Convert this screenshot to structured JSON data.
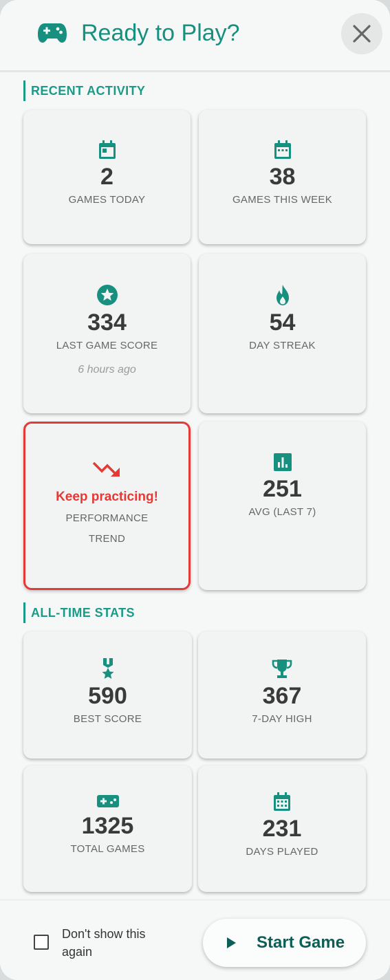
{
  "header": {
    "title": "Ready to Play?",
    "icon": "gamepad-icon",
    "close_icon": "close-icon"
  },
  "colors": {
    "accent": "#17907f",
    "alert": "#e53935",
    "button_text": "#0b5f56"
  },
  "recent": {
    "title": "RECENT ACTIVITY",
    "games_today": {
      "value": "2",
      "label": "GAMES TODAY",
      "icon": "calendar-today-icon"
    },
    "games_week": {
      "value": "38",
      "label": "GAMES THIS WEEK",
      "icon": "calendar-week-icon"
    },
    "last_score": {
      "value": "334",
      "label": "LAST GAME SCORE",
      "meta": "6 hours ago",
      "icon": "star-icon"
    },
    "streak": {
      "value": "54",
      "label": "DAY STREAK",
      "icon": "fire-icon"
    },
    "trend": {
      "message": "Keep practicing!",
      "label_line1": "PERFORMANCE",
      "label_line2": "TREND",
      "icon": "trending-down-icon"
    },
    "avg": {
      "value": "251",
      "label": "AVG (LAST 7)",
      "icon": "bar-chart-icon"
    }
  },
  "alltime": {
    "title": "ALL-TIME STATS",
    "best": {
      "value": "590",
      "label": "BEST SCORE",
      "icon": "medal-icon"
    },
    "high7": {
      "value": "367",
      "label": "7-DAY HIGH",
      "icon": "trophy-icon"
    },
    "total": {
      "value": "1325",
      "label": "TOTAL GAMES",
      "icon": "gamepad-icon"
    },
    "days": {
      "value": "231",
      "label": "DAYS PLAYED",
      "icon": "calendar-month-icon"
    }
  },
  "footer": {
    "checkbox_label": "Don't show this again",
    "checkbox_checked": false,
    "start_label": "Start Game",
    "start_icon": "play-icon"
  }
}
